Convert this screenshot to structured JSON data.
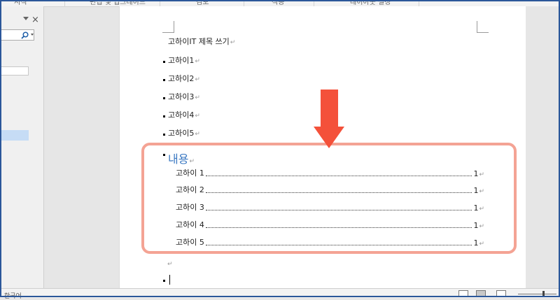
{
  "ribbon": {
    "groups": [
      "서식",
      "편집 및 업그레이드",
      "검토",
      "적용",
      "레이아웃 설정"
    ]
  },
  "nav_pane": {
    "close_glyph": "×",
    "search_icon": "search-icon"
  },
  "document": {
    "title_line": "고하이IT 제목 쓰기",
    "list_items": [
      "고하이1",
      "고하이2",
      "고하이3",
      "고하이4",
      "고하이5"
    ],
    "paragraph_mark": "↵",
    "toc_heading": "내용",
    "toc_entries": [
      {
        "text": "고하이 1",
        "page": "1"
      },
      {
        "text": "고하이 2",
        "page": "1"
      },
      {
        "text": "고하이 3",
        "page": "1"
      },
      {
        "text": "고하이 4",
        "page": "1"
      },
      {
        "text": "고하이 5",
        "page": "1"
      }
    ]
  },
  "status_bar": {
    "language": "한국어"
  },
  "colors": {
    "accent_heading": "#3a78c2",
    "highlight_border": "#f4a394",
    "arrow": "#f4513a",
    "window_border": "#2b579a"
  }
}
